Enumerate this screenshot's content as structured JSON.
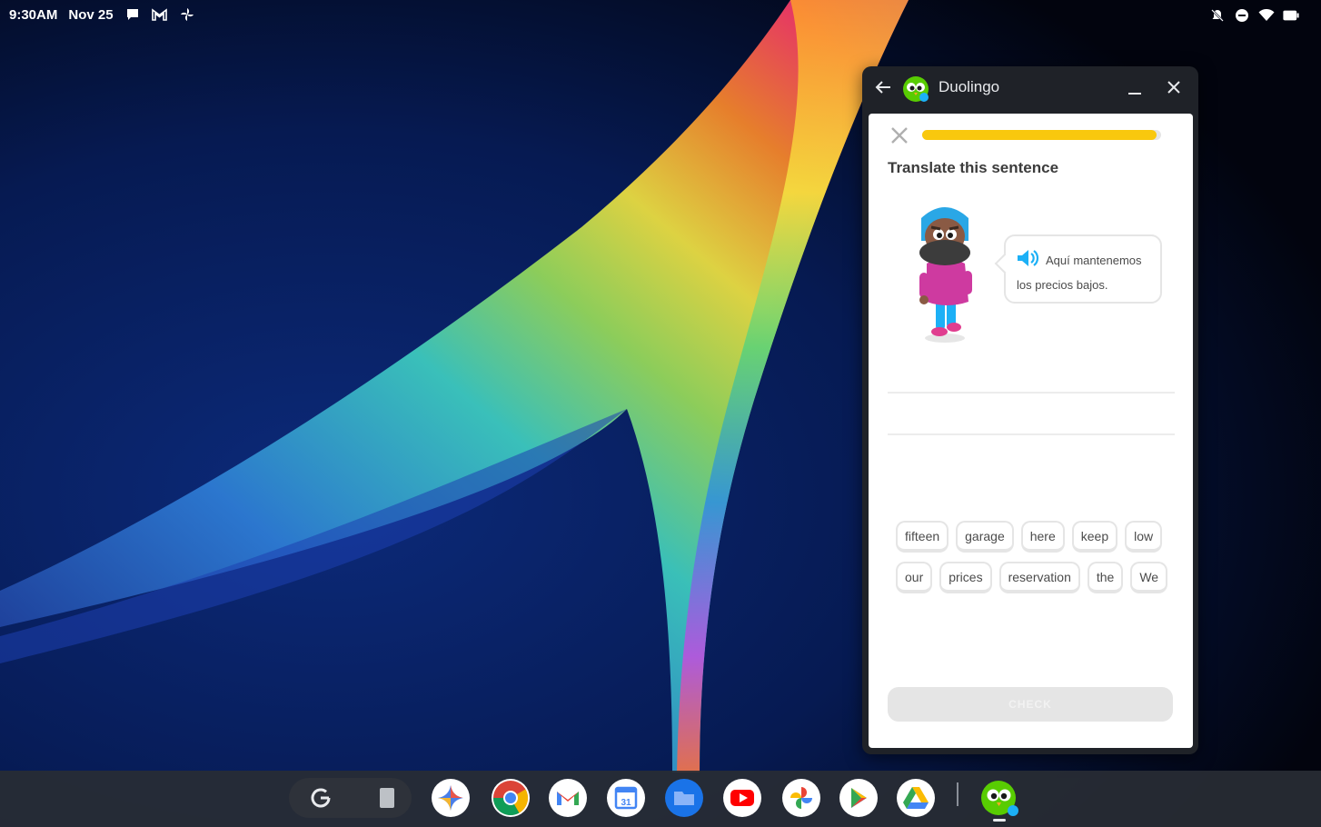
{
  "status_bar": {
    "time": "9:30AM",
    "date": "Nov 25",
    "left_icons": [
      "chat-icon",
      "gmail-icon",
      "pinwheel-icon"
    ],
    "right_icons": [
      "notifications-off-icon",
      "do-not-disturb-icon",
      "wifi-icon",
      "battery-icon"
    ]
  },
  "window": {
    "title": "Duolingo",
    "controls": [
      "back-arrow-icon",
      "minimize-icon",
      "close-icon"
    ]
  },
  "lesson": {
    "progress": 0.98,
    "prompt": "Translate this sentence",
    "sentence": "Aquí mantenemos los precios bajos.",
    "word_bank": [
      [
        "fifteen",
        "garage",
        "here",
        "keep",
        "low"
      ],
      [
        "our",
        "prices",
        "reservation",
        "the",
        "We"
      ]
    ],
    "check_label": "CHECK"
  },
  "shelf": {
    "apps": [
      "google-launcher-icon",
      "files-recent-icon",
      "gemini-icon",
      "chrome-icon",
      "gmail-icon",
      "calendar-icon",
      "files-icon",
      "youtube-icon",
      "photos-icon",
      "play-store-icon",
      "drive-icon",
      "duolingo-icon"
    ],
    "calendar_day": "31"
  },
  "colors": {
    "progress_fill": "#f9c80e",
    "duolingo_green": "#58cc02",
    "speaker_blue": "#1cb0f6"
  }
}
